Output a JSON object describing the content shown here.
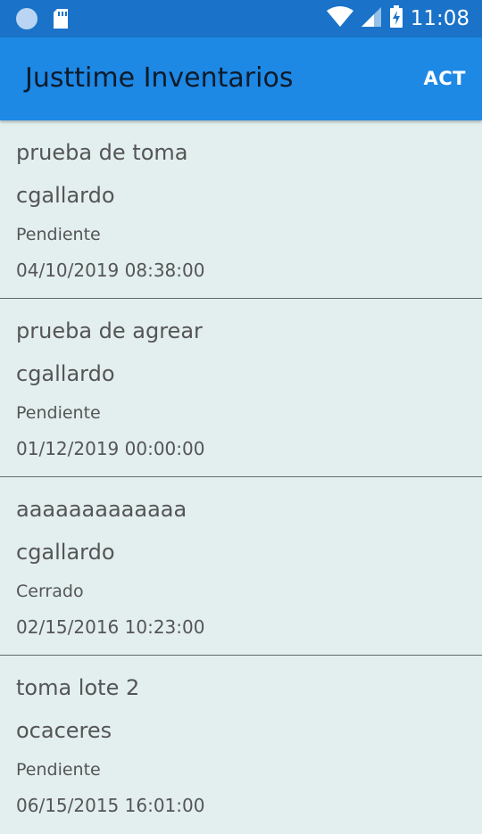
{
  "status_bar": {
    "time": "11:08"
  },
  "app_bar": {
    "title": "Justtime Inventarios",
    "action_label": "ACT"
  },
  "items": [
    {
      "name": "prueba de toma",
      "user": "cgallardo",
      "status": "Pendiente",
      "date": "04/10/2019 08:38:00"
    },
    {
      "name": "prueba de agrear",
      "user": "cgallardo",
      "status": "Pendiente",
      "date": "01/12/2019 00:00:00"
    },
    {
      "name": "aaaaaaaaaaaaa",
      "user": "cgallardo",
      "status": "Cerrado",
      "date": "02/15/2016 10:23:00"
    },
    {
      "name": "toma lote 2",
      "user": "ocaceres",
      "status": "Pendiente",
      "date": "06/15/2015 16:01:00"
    }
  ]
}
